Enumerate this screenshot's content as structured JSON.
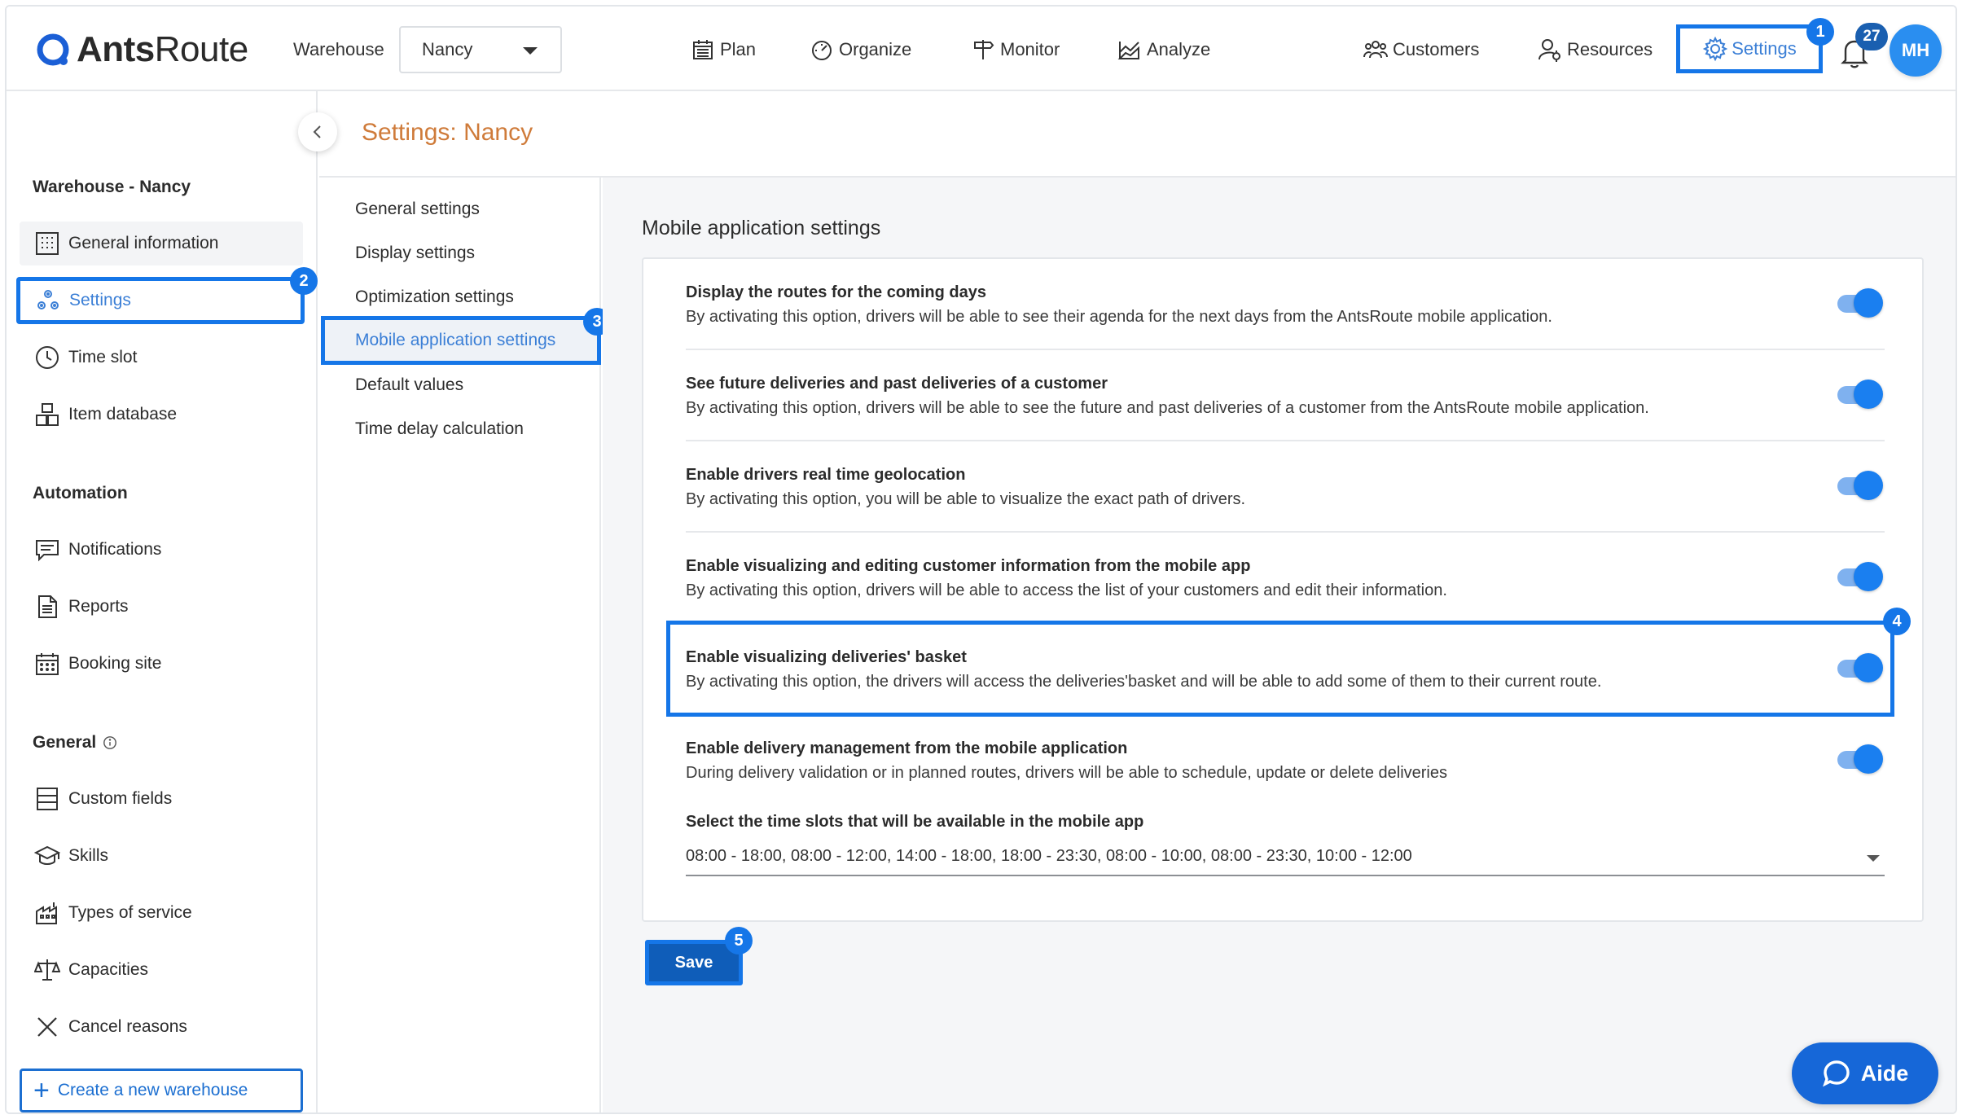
{
  "app": {
    "logo_text_bold": "Ants",
    "logo_text_rest": "Route",
    "accent_color": "#1576e8",
    "title_color": "#cf7b3a"
  },
  "header": {
    "warehouse_label": "Warehouse",
    "warehouse_value": "Nancy",
    "nav": [
      {
        "label": "Plan",
        "icon": "calendar-icon"
      },
      {
        "label": "Organize",
        "icon": "gauge-icon"
      },
      {
        "label": "Monitor",
        "icon": "signpost-icon"
      },
      {
        "label": "Analyze",
        "icon": "chart-icon"
      },
      {
        "label": "Customers",
        "icon": "people-icon"
      },
      {
        "label": "Resources",
        "icon": "user-gear-icon"
      },
      {
        "label": "Settings",
        "icon": "gear-icon"
      }
    ],
    "notification_count": "27",
    "avatar_initials": "MH",
    "step_badges": [
      "1",
      "2",
      "3",
      "4",
      "5"
    ]
  },
  "sidebar": {
    "warehouse_title": "Warehouse - Nancy",
    "warehouse_items": [
      {
        "label": "General information",
        "icon": "building-icon"
      },
      {
        "label": "Settings",
        "icon": "cogs-icon"
      },
      {
        "label": "Time slot",
        "icon": "clock-icon"
      },
      {
        "label": "Item database",
        "icon": "boxes-icon"
      }
    ],
    "automation_title": "Automation",
    "automation_items": [
      {
        "label": "Notifications",
        "icon": "message-icon"
      },
      {
        "label": "Reports",
        "icon": "document-icon"
      },
      {
        "label": "Booking site",
        "icon": "calendar-grid-icon"
      }
    ],
    "general_title": "General",
    "general_items": [
      {
        "label": "Custom fields",
        "icon": "list-icon"
      },
      {
        "label": "Skills",
        "icon": "graduation-cap-icon"
      },
      {
        "label": "Types of service",
        "icon": "factory-icon"
      },
      {
        "label": "Capacities",
        "icon": "scale-icon"
      },
      {
        "label": "Cancel reasons",
        "icon": "x-icon"
      }
    ],
    "create_button": "Create a new warehouse"
  },
  "page": {
    "title": "Settings: Nancy"
  },
  "submenu": {
    "items": [
      "General settings",
      "Display settings",
      "Optimization settings",
      "Mobile application settings",
      "Default values",
      "Time delay calculation"
    ],
    "selected_index": 3
  },
  "content": {
    "title": "Mobile application settings",
    "options": [
      {
        "title": "Display the routes for the coming days",
        "description": "By activating this option, drivers will be able to see their agenda for the next days from the AntsRoute mobile application.",
        "enabled": true
      },
      {
        "title": "See future deliveries and past deliveries of a customer",
        "description": "By activating this option, drivers will be able to see the future and past deliveries of a customer from the AntsRoute mobile application.",
        "enabled": true
      },
      {
        "title": "Enable drivers real time geolocation",
        "description": "By activating this option, you will be able to visualize the exact path of drivers.",
        "enabled": true
      },
      {
        "title": "Enable visualizing and editing customer information from the mobile app",
        "description": "By activating this option, drivers will be able to access the list of your customers and edit their information.",
        "enabled": true
      },
      {
        "title": "Enable visualizing deliveries' basket",
        "description": "By activating this option, the drivers will access the deliveries'basket and will be able to add some of them to their current route.",
        "enabled": true
      },
      {
        "title": "Enable delivery management from the mobile application",
        "description": "During delivery validation or in planned routes, drivers will be able to schedule, update or delete deliveries",
        "enabled": true
      }
    ],
    "time_slots_label": "Select the time slots that will be available in the mobile app",
    "time_slots_value": "08:00 - 18:00, 08:00 - 12:00, 14:00 - 18:00, 18:00 - 23:30, 08:00 - 10:00, 08:00 - 23:30, 10:00 - 12:00",
    "save_button": "Save"
  },
  "help": {
    "label": "Aide"
  }
}
